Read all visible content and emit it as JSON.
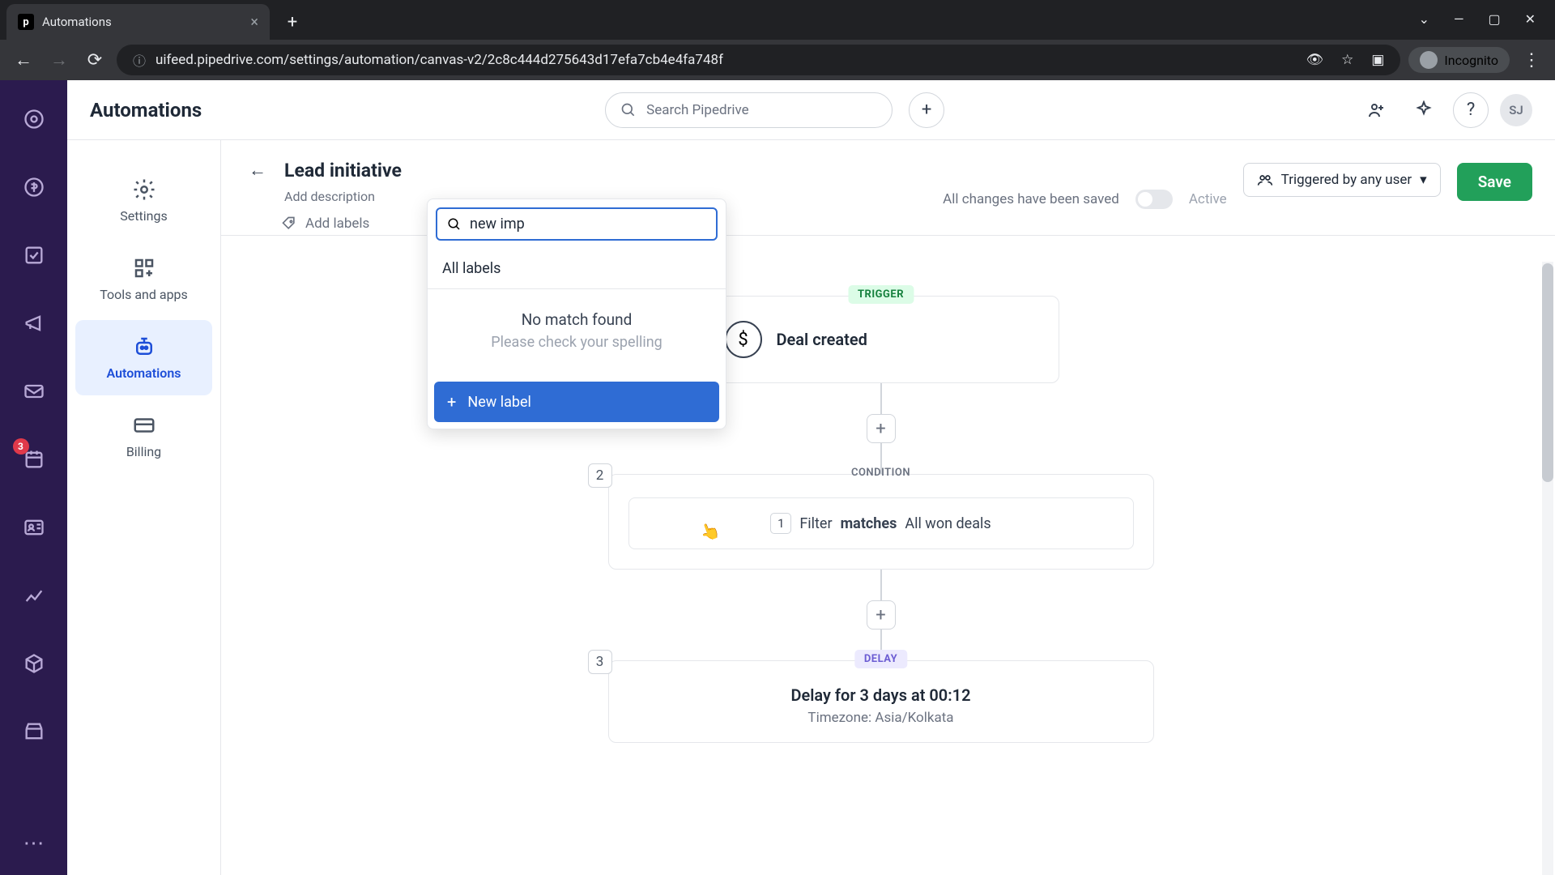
{
  "browser": {
    "tab_title": "Automations",
    "url": "uifeed.pipedrive.com/settings/automation/canvas-v2/2c8c444d275643d17efa7cb4e4fa748f",
    "incognito_label": "Incognito"
  },
  "rail_badge": "3",
  "topbar": {
    "title": "Automations",
    "search_placeholder": "Search Pipedrive",
    "avatar_initials": "SJ"
  },
  "sidebar2": {
    "items": [
      {
        "label": "Settings"
      },
      {
        "label": "Tools and apps"
      },
      {
        "label": "Automations"
      },
      {
        "label": "Billing"
      }
    ]
  },
  "header": {
    "title": "Lead initiative",
    "description_placeholder": "Add description",
    "add_labels": "Add labels",
    "saved_text": "All changes have been saved",
    "active_label": "Active",
    "trigger_dd": "Triggered by any user",
    "save_btn": "Save"
  },
  "label_popover": {
    "search_value": "new imp",
    "all_labels": "All labels",
    "no_match_title": "No match found",
    "no_match_sub": "Please check your spelling",
    "new_label_btn": "New label"
  },
  "flow": {
    "trigger_badge": "TRIGGER",
    "trigger_text": "Deal created",
    "condition_badge": "CONDITION",
    "step2": "2",
    "filter_num": "1",
    "filter_label": "Filter",
    "filter_op": "matches",
    "filter_value": "All won deals",
    "delay_badge": "DELAY",
    "step3": "3",
    "delay_text": "Delay for 3 days at 00:12",
    "delay_sub": "Timezone: Asia/Kolkata"
  }
}
